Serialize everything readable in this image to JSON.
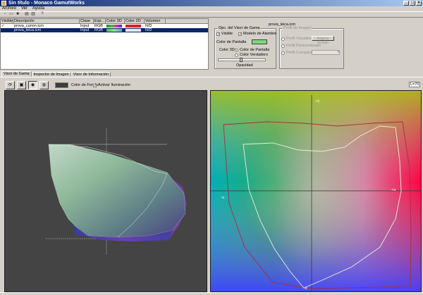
{
  "window": {
    "title": "Sin título - Monaco GamutWorks"
  },
  "menu": [
    "Archivo",
    "Ver",
    "Ayuda"
  ],
  "toolbar_icons": [
    "new-icon",
    "open-icon",
    "save-icon",
    "print-icon",
    "print-preview-icon",
    "help-icon"
  ],
  "profiles": {
    "headers": [
      "Visible",
      "Descripción",
      "Clase",
      "Esp...",
      "Color 3D",
      "Color 2D",
      "Volumen"
    ],
    "rows": [
      {
        "visible": "✓",
        "description": "prova_canon.icm",
        "clase": "Input",
        "esp": "RGB",
        "color3d": "#1a8a3a",
        "color2d": "#e02020",
        "volumen": "N/D",
        "selected": false
      },
      {
        "visible": "",
        "description": "prova_leica.icm",
        "clase": "Input",
        "esp": "RGB",
        "color3d": "#5ab85a",
        "color2d": "#e8e8e8",
        "volumen": "N/D",
        "selected": true
      }
    ]
  },
  "settings": {
    "profile_title": "prova_leica.icm",
    "view_group": "Opc. del Visor de Gama",
    "visible_label": "Visible",
    "wireframe_label": "Modelo de Alambre",
    "screen_color_label": "Color de Pantalla",
    "screen_color": "#7fd67f",
    "color3d_label": "Color 3D:",
    "radio_screen": "Color de Pantalla",
    "radio_true": "Color Verdadero",
    "opacity_label": "Opacidad",
    "image_group": "Perfil de Imagen",
    "radio_profile_source": "Perfil Visualizador",
    "assign_button": "Asignar Incluso",
    "radio_profile_dest": "Perfil Personalizado",
    "radio_profile_custom": "Perfil Comparación"
  },
  "tabs": [
    {
      "label": "Visor de Gama",
      "active": true
    },
    {
      "label": "Inspector de Imagen",
      "active": false
    },
    {
      "label": "Visor de Información",
      "active": false
    }
  ],
  "controls": {
    "background_label": "Color de Fondo",
    "lighting_label": "Activar Iluminación",
    "lightness_value": "L=70",
    "button_icons": [
      "rotate-icon",
      "cube-icon",
      "lighting-icon",
      "sphere-icon"
    ],
    "background_color": "#3c3c3c"
  },
  "plot2d": {
    "plus_a_label": "+b",
    "minus_a_label": "-a",
    "plus_a2_label": "+a",
    "minus_b_label": "-b"
  }
}
